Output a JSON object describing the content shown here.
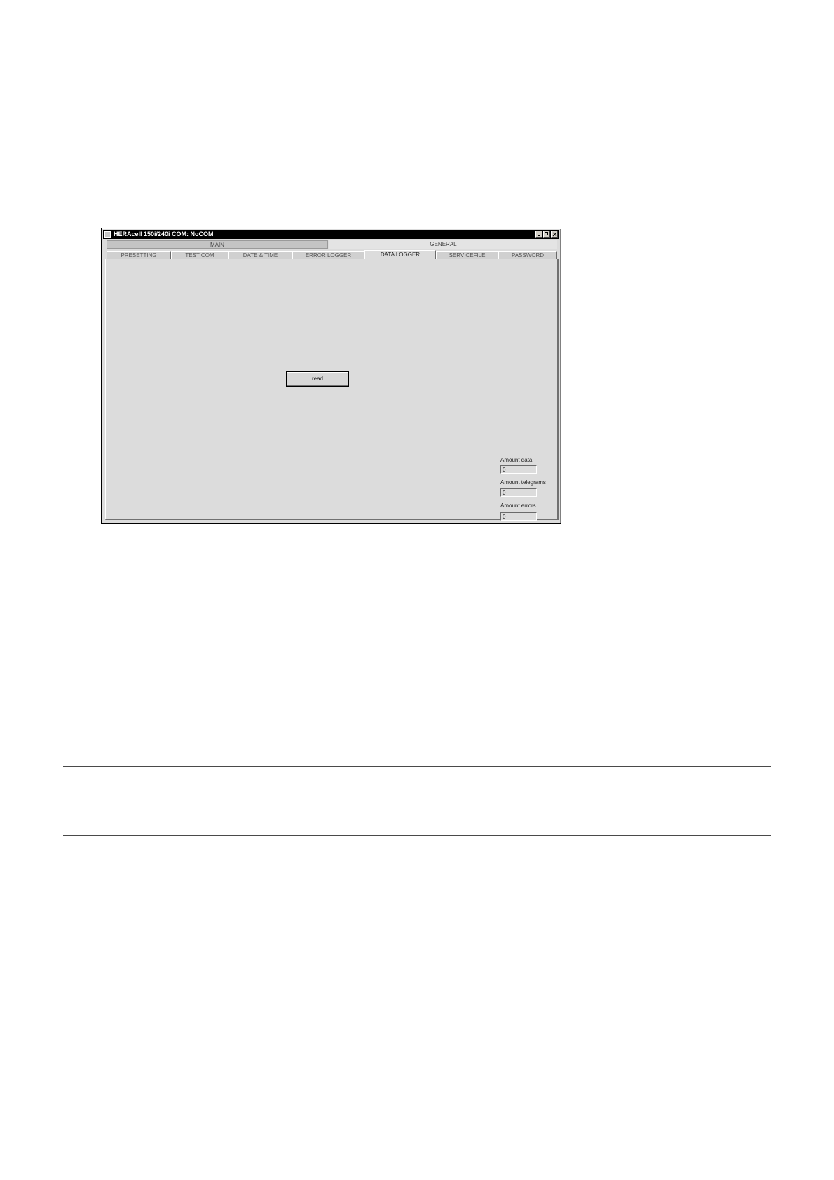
{
  "window": {
    "title": "HERAcell 150i/240i COM: NoCOM"
  },
  "group_tabs": [
    {
      "label": "MAIN"
    },
    {
      "label": "GENERAL",
      "active": true
    }
  ],
  "tabs": [
    {
      "label": "PRESETTING"
    },
    {
      "label": "TEST COM"
    },
    {
      "label": "DATE & TIME"
    },
    {
      "label": "ERROR LOGGER"
    },
    {
      "label": "DATA LOGGER",
      "active": true
    },
    {
      "label": "SERVICEFILE"
    },
    {
      "label": "PASSWORD"
    }
  ],
  "panel": {
    "read_button": "read",
    "stats": [
      {
        "label": "Amount data",
        "value": "0"
      },
      {
        "label": "Amount telegrams",
        "value": "0"
      },
      {
        "label": "Amount errors",
        "value": "0"
      }
    ]
  }
}
